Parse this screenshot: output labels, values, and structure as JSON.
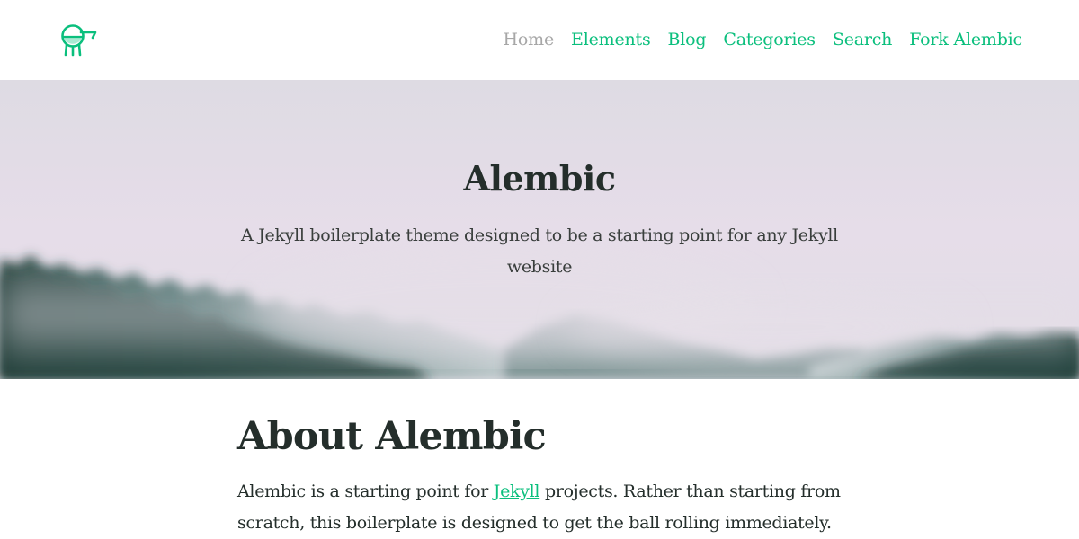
{
  "header": {
    "logo_icon": "alembic-logo-icon",
    "nav": [
      {
        "label": "Home",
        "active": true
      },
      {
        "label": "Elements",
        "active": false
      },
      {
        "label": "Blog",
        "active": false
      },
      {
        "label": "Categories",
        "active": false
      },
      {
        "label": "Search",
        "active": false
      },
      {
        "label": "Fork Alembic",
        "active": false
      }
    ]
  },
  "hero": {
    "title": "Alembic",
    "subtitle": "A Jekyll boilerplate theme designed to be a starting point for any Jekyll website"
  },
  "about": {
    "title": "About Alembic",
    "text_before": "Alembic is a starting point for ",
    "link_text": "Jekyll",
    "text_after": " projects. Rather than starting from scratch, this boilerplate is designed to get the ball rolling immediately."
  },
  "colors": {
    "accent": "#0bbf7d",
    "nav_active": "#a7a7a7",
    "text": "#242e2b",
    "sky": "#e4dde7",
    "forest": "#1d3b36"
  }
}
